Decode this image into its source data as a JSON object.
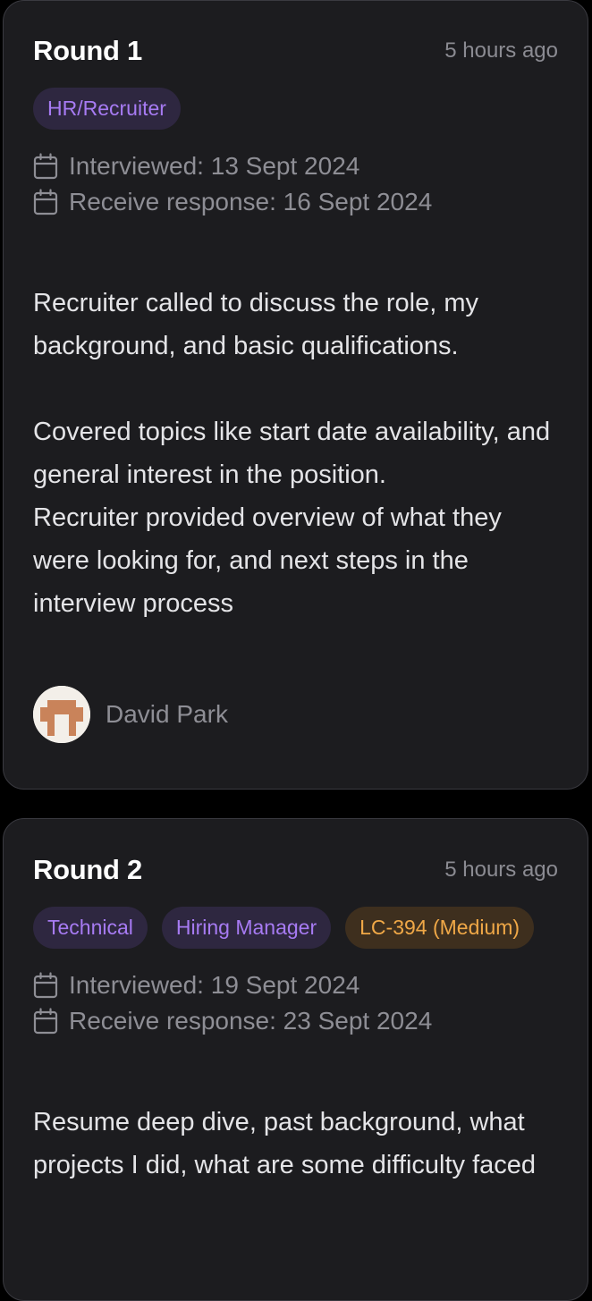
{
  "rounds": [
    {
      "title": "Round 1",
      "time": "5 hours ago",
      "tags": [
        {
          "label": "HR/Recruiter",
          "color": "#a77bf3"
        }
      ],
      "interviewed": "Interviewed: 13 Sept 2024",
      "response": "Receive response: 16 Sept 2024",
      "paragraphs": [
        "Recruiter called to discuss the role, my background, and basic qualifications.",
        "Covered topics like start date availability, and general interest in the position.",
        "Recruiter provided overview of what they were looking for, and next steps in the interview process"
      ],
      "author": {
        "name": "David Park",
        "avatar_icon": "pixel-avatar-icon"
      }
    },
    {
      "title": "Round 2",
      "time": "5 hours ago",
      "tags": [
        {
          "label": "Technical",
          "color": "#a77bf3"
        },
        {
          "label": "Hiring Manager",
          "color": "#a77bf3"
        },
        {
          "label": "LC-394 (Medium)",
          "color": "#f0a847"
        }
      ],
      "interviewed": "Interviewed: 19 Sept 2024",
      "response": "Receive response: 23 Sept 2024",
      "paragraphs": [
        "Resume deep dive, past background, what projects I did, what are some difficulty faced"
      ]
    }
  ],
  "icons": {
    "calendar": "calendar-icon"
  },
  "colors": {
    "page_bg": "#000000",
    "card_bg": "#1c1c1f",
    "card_border": "#3a3a40",
    "tag_purple_bg": "#2e2740",
    "tag_purple_text": "#a77bf3",
    "tag_orange_bg": "#3e2f1e",
    "tag_orange_text": "#f0a847",
    "avatar_brown": "#c9835a"
  }
}
